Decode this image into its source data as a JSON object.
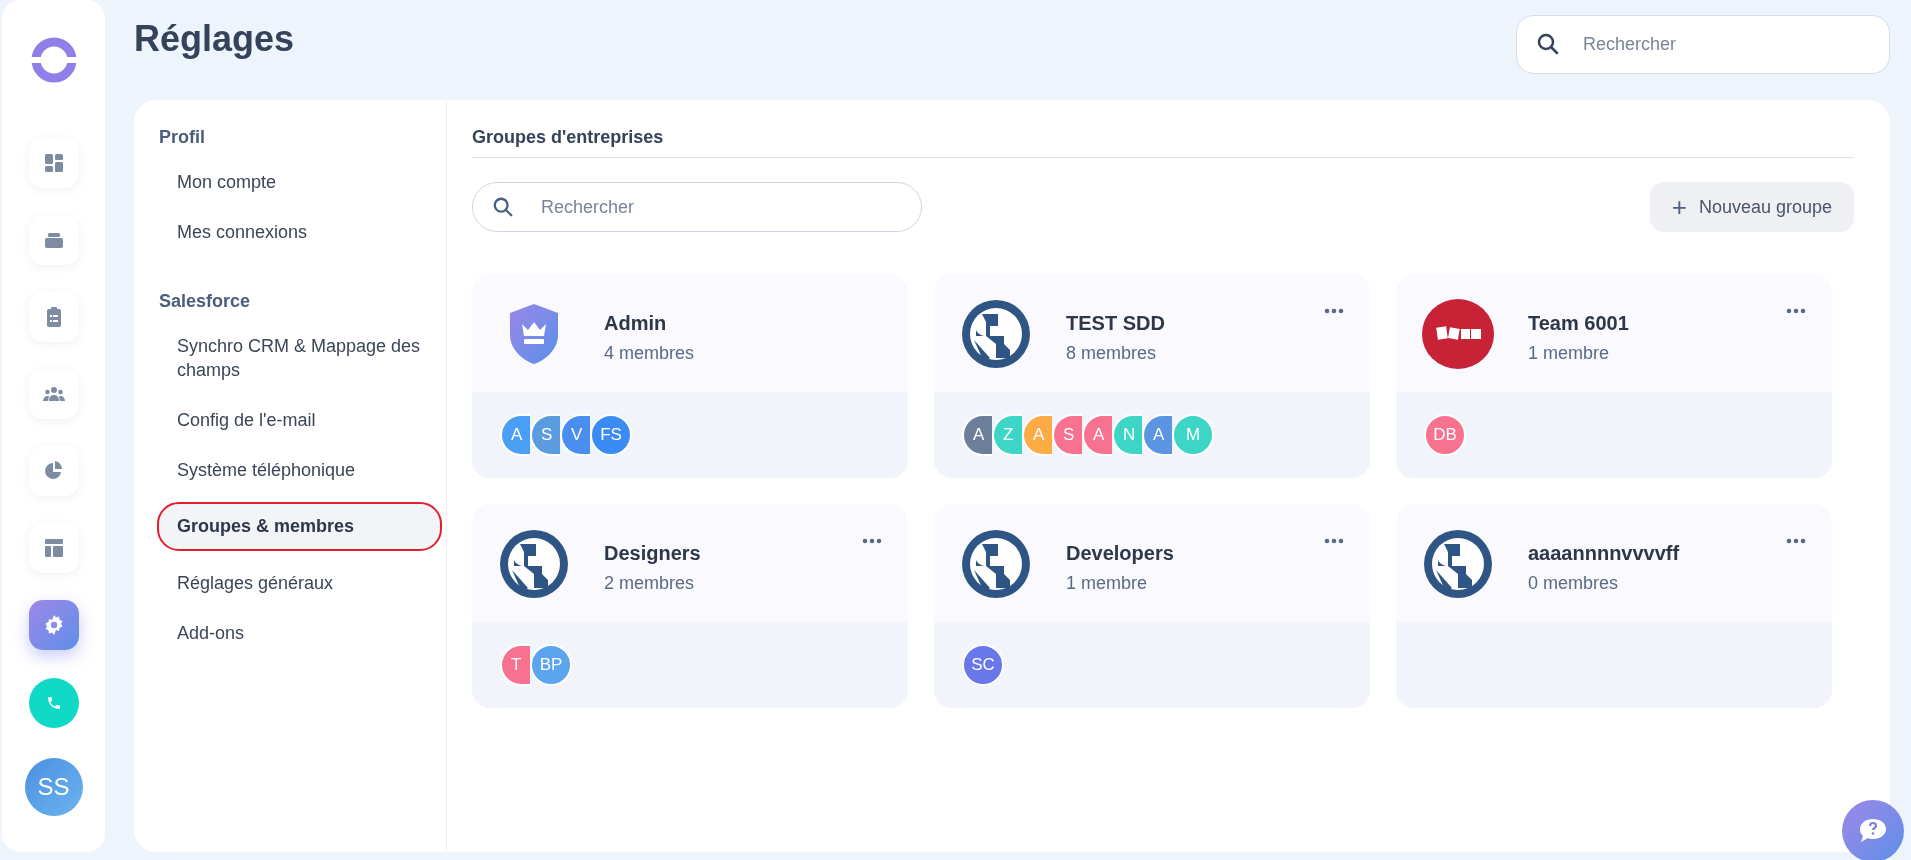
{
  "page_title": "Réglages",
  "top_search": {
    "placeholder": "Rechercher"
  },
  "rail": [
    {
      "selected": false
    },
    {
      "selected": false
    },
    {
      "selected": false
    },
    {
      "selected": false
    },
    {
      "selected": false
    },
    {
      "selected": false
    },
    {
      "selected": true
    }
  ],
  "user_avatar": "SS",
  "settings_nav": [
    {
      "heading": "Profil",
      "items": [
        {
          "label": "Mon compte",
          "selected": false
        },
        {
          "label": "Mes connexions",
          "selected": false
        }
      ]
    },
    {
      "heading": "Salesforce",
      "items": [
        {
          "label": "Synchro CRM & Mappage des champs",
          "selected": false
        },
        {
          "label": "Config de l'e-mail",
          "selected": false
        },
        {
          "label": "Système téléphonique",
          "selected": false
        },
        {
          "label": "Groupes & membres",
          "selected": true
        },
        {
          "label": "Réglages généraux",
          "selected": false
        },
        {
          "label": "Add-ons",
          "selected": false
        }
      ]
    }
  ],
  "section_title": "Groupes d'entreprises",
  "group_search": {
    "placeholder": "Rechercher"
  },
  "new_group_button": {
    "icon": "+",
    "label": "Nouveau groupe"
  },
  "groups": [
    {
      "name": "Admin",
      "count": "4 membres",
      "kind": "admin",
      "menu": false,
      "members": [
        {
          "initials": "A",
          "color": "#4a9ff5"
        },
        {
          "initials": "S",
          "color": "#5b9be0"
        },
        {
          "initials": "V",
          "color": "#4a8ff0"
        },
        {
          "initials": "FS",
          "color": "#3b8bf5"
        }
      ]
    },
    {
      "name": "TEST SDD",
      "count": "8 membres",
      "kind": "globe",
      "menu": true,
      "members": [
        {
          "initials": "A",
          "color": "#6b7f9a"
        },
        {
          "initials": "Z",
          "color": "#3dd6c6"
        },
        {
          "initials": "A",
          "color": "#fdab45"
        },
        {
          "initials": "S",
          "color": "#f7728f"
        },
        {
          "initials": "A",
          "color": "#f7728f"
        },
        {
          "initials": "N",
          "color": "#3dd6c6"
        },
        {
          "initials": "A",
          "color": "#5b94e0"
        },
        {
          "initials": "M",
          "color": "#3dd6c6"
        }
      ]
    },
    {
      "name": "Team 6001",
      "count": "1 membre",
      "kind": "tiles",
      "menu": true,
      "members": [
        {
          "initials": "DB",
          "color": "#f7728f"
        }
      ]
    },
    {
      "name": "Designers",
      "count": "2 membres",
      "kind": "globe",
      "menu": true,
      "members": [
        {
          "initials": "T",
          "color": "#f7728f"
        },
        {
          "initials": "BP",
          "color": "#5ba4ee"
        }
      ]
    },
    {
      "name": "Developers",
      "count": "1 membre",
      "kind": "globe",
      "menu": true,
      "members": [
        {
          "initials": "SC",
          "color": "#6a77ea"
        }
      ]
    },
    {
      "name": "aaaannnnvvvvff",
      "count": "0 membres",
      "kind": "globe",
      "menu": true
    }
  ]
}
